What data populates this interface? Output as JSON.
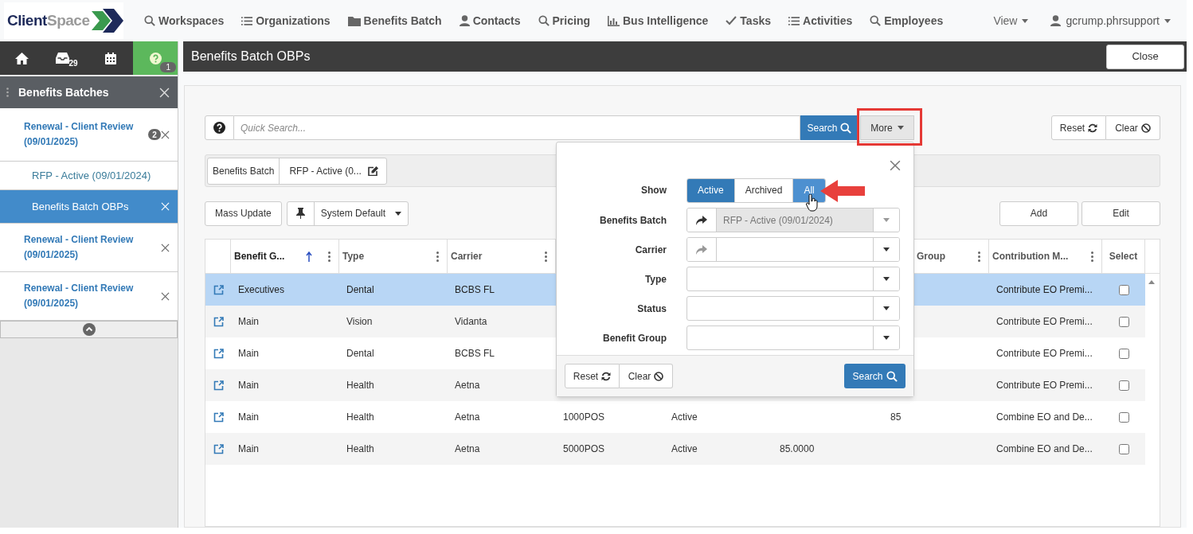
{
  "nav": {
    "logo": [
      "Client",
      "Space"
    ],
    "items": [
      {
        "label": "Workspaces"
      },
      {
        "label": "Organizations"
      },
      {
        "label": "Benefits Batch"
      },
      {
        "label": "Contacts"
      },
      {
        "label": "Pricing"
      },
      {
        "label": "Bus Intelligence"
      },
      {
        "label": "Tasks"
      },
      {
        "label": "Activities"
      },
      {
        "label": "Employees"
      }
    ],
    "view": "View",
    "user": "gcrump.phrsupport"
  },
  "sidebar": {
    "tabs": [
      {
        "selected": false
      },
      {
        "badge": "29",
        "selected": false
      },
      {
        "selected": false
      },
      {
        "badge": "1",
        "selected": true
      }
    ],
    "title": "Benefits Batches",
    "items": [
      {
        "label": "Renewal - Client Review (09/01/2025)",
        "kind": "parent",
        "badge": "2",
        "closable": true,
        "selected": false
      },
      {
        "label": "RFP - Active (09/01/2024)",
        "kind": "child",
        "closable": false,
        "selected": false
      },
      {
        "label": "Benefits Batch OBPs",
        "kind": "child",
        "closable": true,
        "selected": true
      },
      {
        "label": "Renewal - Client Review (09/01/2025)",
        "kind": "parent",
        "closable": true,
        "selected": false
      },
      {
        "label": "Renewal - Client Review (09/01/2025)",
        "kind": "parent",
        "closable": true,
        "selected": false
      }
    ]
  },
  "main": {
    "title": "Benefits Batch OBPs",
    "close_button": "Close",
    "search": {
      "placeholder": "Quick Search...",
      "search_button": "Search",
      "more_button": "More",
      "reset_button": "Reset",
      "clear_button": "Clear"
    },
    "breadcrumb": [
      "Benefits Batch",
      "RFP - Active (0..."
    ],
    "toolbar": {
      "mass_update": "Mass Update",
      "layout": "System Default",
      "add": "Add",
      "edit": "Edit"
    },
    "table": {
      "columns": [
        {
          "label": "Benefit G...",
          "sorted": true
        },
        {
          "label": "Type",
          "sorted": false
        },
        {
          "label": "Carrier",
          "sorted": false
        },
        {
          "label": "Group",
          "sorted": false
        },
        {
          "label": "Contribution M...",
          "sorted": false
        },
        {
          "label": "Select",
          "sorted": false
        }
      ],
      "rows": [
        {
          "benefit_group": "Executives",
          "type": "Dental",
          "carrier": "BCBS FL",
          "contribution_method": "Contribute EO Premi...",
          "selected": true,
          "checked": false
        },
        {
          "benefit_group": "Main",
          "type": "Vision",
          "carrier": "Vidanta",
          "contribution_method": "Contribute EO Premi...",
          "selected": false,
          "checked": false
        },
        {
          "benefit_group": "Main",
          "type": "Dental",
          "carrier": "BCBS FL",
          "contribution_method": "Contribute EO Premi...",
          "selected": false,
          "checked": false
        },
        {
          "benefit_group": "Main",
          "type": "Health",
          "carrier": "Aetna",
          "contribution_method": "Contribute EO Premi...",
          "selected": false,
          "checked": false
        },
        {
          "benefit_group": "Main",
          "type": "Health",
          "carrier": "Aetna",
          "column_4": "1000POS",
          "column_5": "Active",
          "column_7": "85",
          "contribution_method": "Combine EO and De...",
          "selected": false,
          "checked": false
        },
        {
          "benefit_group": "Main",
          "type": "Health",
          "carrier": "Aetna",
          "column_4": "5000POS",
          "column_5": "Active",
          "column_6": "85.0000",
          "contribution_method": "Combine EO and De...",
          "selected": false,
          "checked": false
        }
      ]
    },
    "filter": {
      "show_label": "Show",
      "show_options": [
        {
          "label": "Active",
          "selected": true,
          "hovered": false
        },
        {
          "label": "Archived",
          "selected": false,
          "hovered": false
        },
        {
          "label": "All",
          "selected": false,
          "hovered": true
        }
      ],
      "fields": [
        {
          "label": "Benefits Batch",
          "value": "RFP - Active (09/01/2024)",
          "link": true,
          "disabled": true
        },
        {
          "label": "Carrier",
          "link": true,
          "disabled": false
        },
        {
          "label": "Type",
          "link": false,
          "disabled": false
        },
        {
          "label": "Status",
          "link": false,
          "disabled": false
        },
        {
          "label": "Benefit Group",
          "link": false,
          "disabled": false
        }
      ],
      "reset_button": "Reset",
      "clear_button": "Clear",
      "search_button": "Search"
    }
  }
}
